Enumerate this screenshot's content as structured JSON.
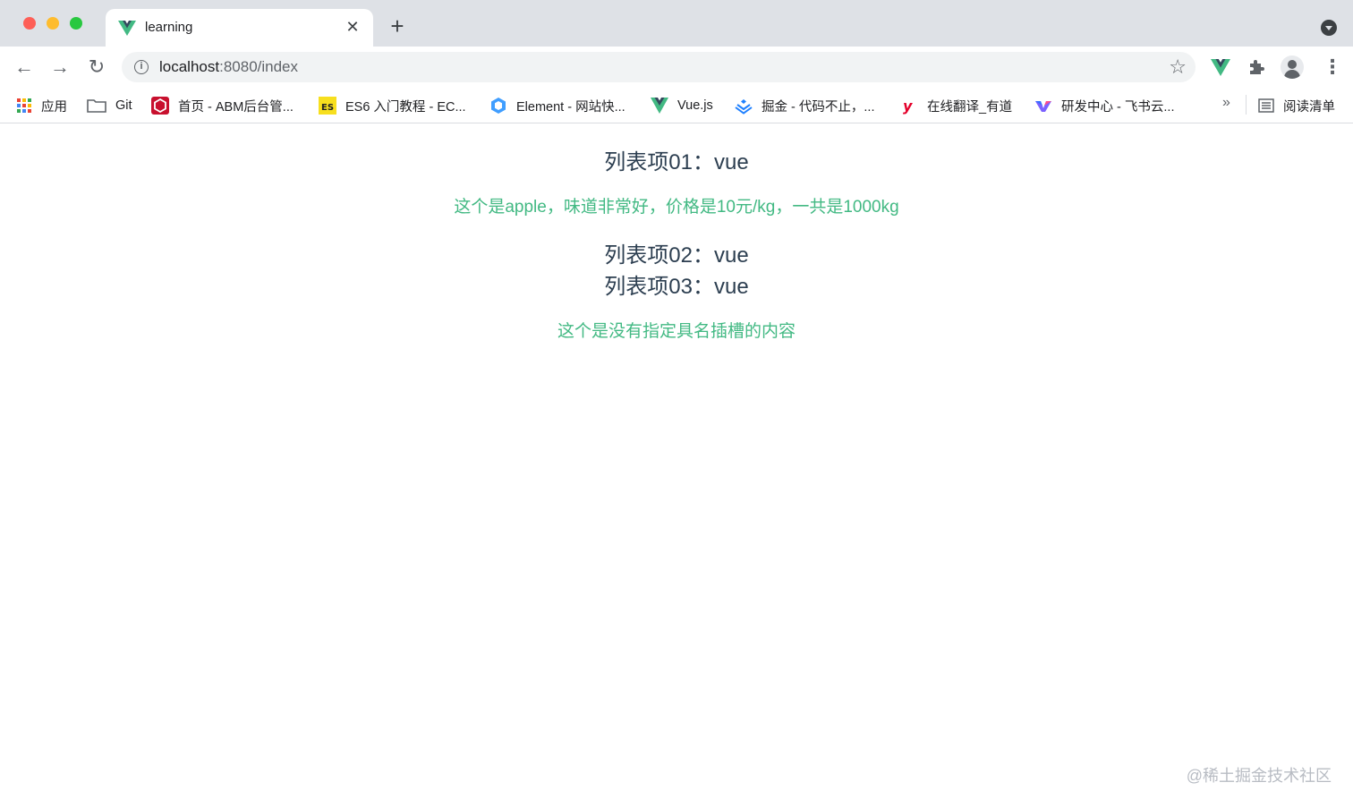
{
  "browser": {
    "tab": {
      "title": "learning",
      "close": "✕"
    },
    "new_tab": "+",
    "nav": {
      "back": "←",
      "forward": "→",
      "reload": "↻"
    },
    "omnibox": {
      "host": "localhost",
      "rest": ":8080/index",
      "info": "i",
      "star": "☆"
    },
    "menu": "⋮",
    "bookmarks": [
      {
        "label": "应用",
        "icon": "apps-grid-icon"
      },
      {
        "label": "Git",
        "icon": "folder-icon"
      },
      {
        "label": "首页 - ABM后台管...",
        "icon": "abm-red-icon"
      },
      {
        "label": "ES6 入门教程 - EC...",
        "icon": "es-yellow-icon"
      },
      {
        "label": "Element - 网站快...",
        "icon": "element-blue-icon"
      },
      {
        "label": "Vue.js",
        "icon": "vue-icon"
      },
      {
        "label": "掘金 - 代码不止，...",
        "icon": "juejin-icon"
      },
      {
        "label": "在线翻译_有道",
        "icon": "youdao-icon"
      },
      {
        "label": "研发中心 - 飞书云...",
        "icon": "feishu-icon"
      }
    ],
    "bookmarks_more": "»",
    "reading_list": "阅读清单"
  },
  "page": {
    "items": [
      {
        "title": "列表项01：vue",
        "text": "这个是apple，味道非常好，价格是10元/kg，一共是1000kg"
      },
      {
        "title": "列表项02：vue",
        "text": ""
      },
      {
        "title": "列表项03：vue",
        "text": "这个是没有指定具名插槽的内容"
      }
    ],
    "watermark": "@稀土掘金技术社区"
  },
  "colors": {
    "vue_green": "#42b983",
    "text_dark": "#2c3e50",
    "tabstrip_bg": "#dee1e6"
  }
}
